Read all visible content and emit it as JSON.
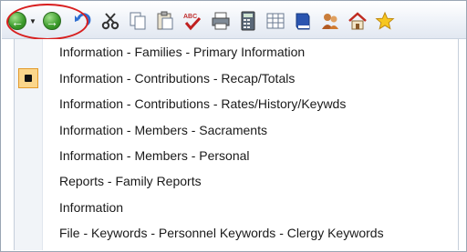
{
  "toolbar": {
    "buttons": [
      {
        "name": "back-icon",
        "glyph": "←"
      },
      {
        "name": "forward-icon",
        "glyph": "→"
      },
      {
        "name": "undo-icon"
      },
      {
        "name": "cut-icon"
      },
      {
        "name": "copy-icon"
      },
      {
        "name": "paste-icon"
      },
      {
        "name": "spellcheck-icon",
        "text": "ABC"
      },
      {
        "name": "print-icon"
      },
      {
        "name": "calculator-icon"
      },
      {
        "name": "table-icon"
      },
      {
        "name": "book-icon"
      },
      {
        "name": "people-icon"
      },
      {
        "name": "home-icon"
      },
      {
        "name": "star-icon"
      }
    ],
    "highlight_color": "#d81f1f"
  },
  "menu": {
    "items": [
      {
        "label": "Information - Families - Primary Information",
        "checked": false
      },
      {
        "label": "Information - Contributions - Recap/Totals",
        "checked": true
      },
      {
        "label": "Information - Contributions - Rates/History/Keywds",
        "checked": false
      },
      {
        "label": "Information - Members - Sacraments",
        "checked": false
      },
      {
        "label": "Information - Members - Personal",
        "checked": false
      },
      {
        "label": "Reports - Family Reports",
        "checked": false
      },
      {
        "label": "Information",
        "checked": false
      },
      {
        "label": "File - Keywords - Personnel Keywords - Clergy Keywords",
        "checked": false
      }
    ]
  }
}
